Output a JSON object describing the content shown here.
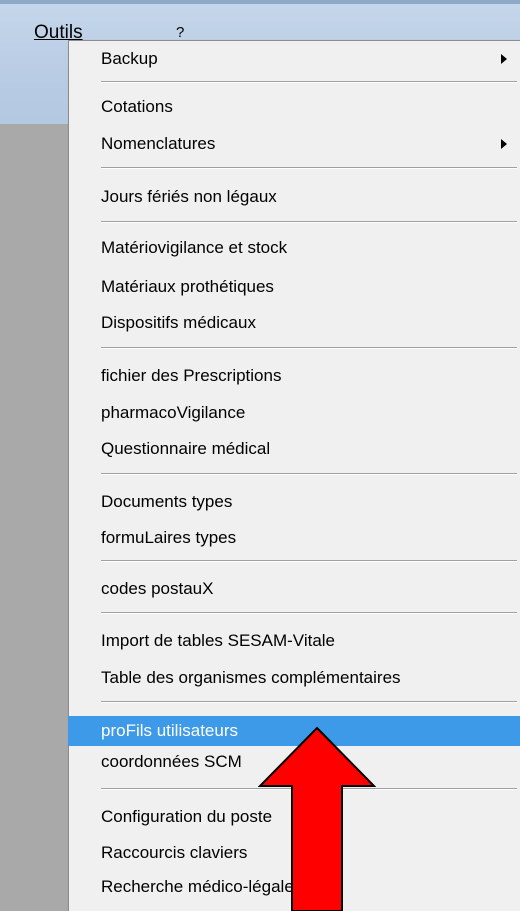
{
  "menubar": {
    "tools_label": "Outils",
    "help_label": "?"
  },
  "menu": {
    "backup": "Backup",
    "cotations": "Cotations",
    "nomenclatures": "Nomenclatures",
    "jours_feries": "Jours fériés non légaux",
    "materiovigilance": "Matériovigilance et stock",
    "materiaux_prothetiques": "Matériaux prothétiques",
    "dispositifs_medicaux": "Dispositifs médicaux",
    "fichier_prescriptions": "fichier des Prescriptions",
    "pharmacovigilance": "pharmacoVigilance",
    "questionnaire_medical": "Questionnaire médical",
    "documents_types": "Documents types",
    "formulaires_types": "formuLaires types",
    "codes_postaux": "codes postauX",
    "import_sesam": "Import de tables SESAM-Vitale",
    "table_organismes": "Table des organismes complémentaires",
    "profils_utilisateurs": "proFils utilisateurs",
    "coordonnees_scm": "coordonnées SCM",
    "configuration_poste": "Configuration du poste",
    "raccourcis_claviers": "Raccourcis claviers",
    "recherche_medico": "Recherche médico-légale"
  },
  "colors": {
    "highlight": "#3d9ae8",
    "annotation_arrow": "#ff0000"
  }
}
